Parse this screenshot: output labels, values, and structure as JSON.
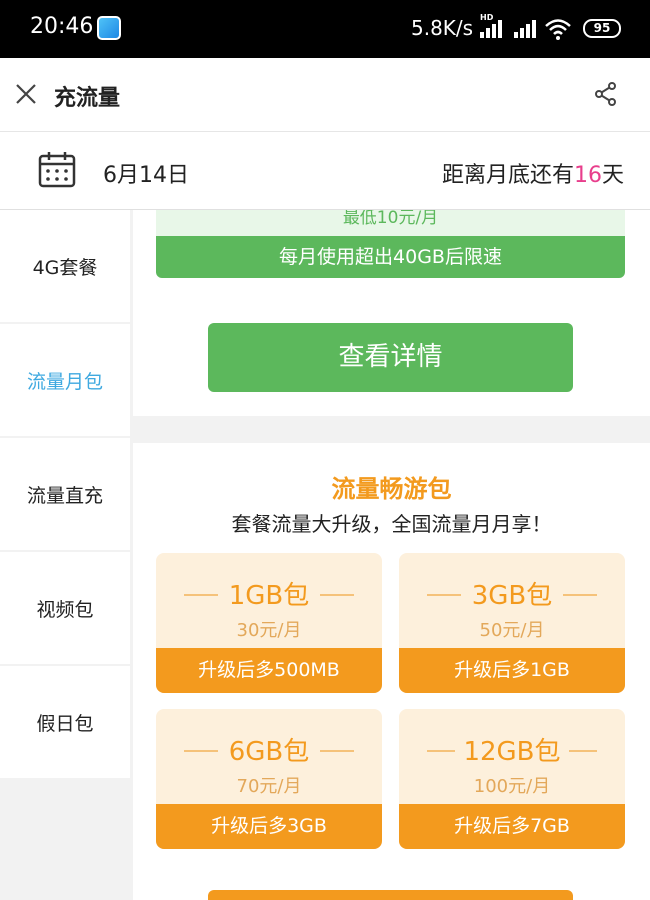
{
  "status_bar": {
    "time": "20:46",
    "net_speed": "5.8K/s",
    "hd_label": "HD",
    "battery": "95",
    "app_icon": "china-mobile-icon"
  },
  "header": {
    "title": "充流量",
    "close_icon": "close-icon",
    "share_icon": "share-icon"
  },
  "date_bar": {
    "date": "6月14日",
    "remain_prefix": "距离月底还有",
    "remain_days": "16",
    "remain_suffix": "天",
    "highlight_color": "#e83e8c"
  },
  "sidebar": {
    "items": [
      {
        "label": "4G套餐",
        "active": false
      },
      {
        "label": "流量月包",
        "active": true
      },
      {
        "label": "流量直充",
        "active": false
      },
      {
        "label": "视频包",
        "active": false
      },
      {
        "label": "假日包",
        "active": false
      }
    ],
    "active_color": "#3fa9e0"
  },
  "monthly_card": {
    "min_price": "最低10元/月",
    "limit_note": "每月使用超出40GB后限速",
    "detail_button": "查看详情",
    "accent": "#5cb85c"
  },
  "travel_pack": {
    "title": "流量畅游包",
    "subtitle": "套餐流量大升级，全国流量月月享！",
    "accent": "#f39a1e",
    "packages": [
      {
        "name": "1GB包",
        "price": "30元/月",
        "upgrade": "升级后多500MB"
      },
      {
        "name": "3GB包",
        "price": "50元/月",
        "upgrade": "升级后多1GB"
      },
      {
        "name": "6GB包",
        "price": "70元/月",
        "upgrade": "升级后多3GB"
      },
      {
        "name": "12GB包",
        "price": "100元/月",
        "upgrade": "升级后多7GB"
      }
    ]
  }
}
